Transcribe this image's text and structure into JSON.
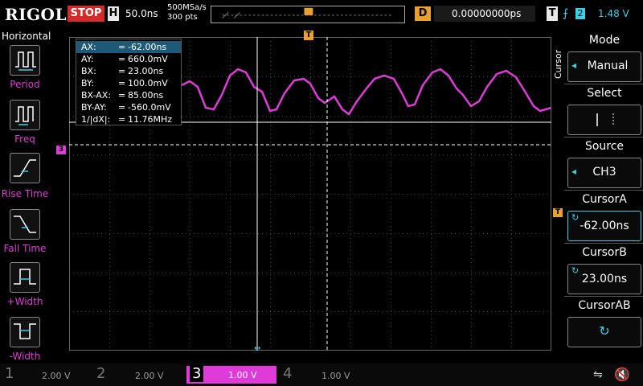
{
  "top": {
    "brand": "RIGOL",
    "run_state": "STOP",
    "h_badge": "H",
    "timebase": "50.0ns",
    "sample_rate": "500MSa/s",
    "points": "300 pts",
    "d_badge": "D",
    "delay": "0.00000000ps",
    "t_badge": "T",
    "trigger_edge_glyph": "⨍",
    "trigger_source": "2",
    "trigger_level": "1.48 V"
  },
  "left_menu": {
    "title": "Horizontal",
    "items": [
      {
        "label": "Period"
      },
      {
        "label": "Freq"
      },
      {
        "label": "Rise Time"
      },
      {
        "label": "Fall Time"
      },
      {
        "label": "+Width"
      },
      {
        "label": "-Width"
      }
    ]
  },
  "cursor_readout": {
    "rows": [
      {
        "k": "AX:",
        "eq": "=",
        "v": "-62.00ns"
      },
      {
        "k": "AY:",
        "eq": "=",
        "v": "660.0mV"
      },
      {
        "k": "BX:",
        "eq": "=",
        "v": "23.00ns"
      },
      {
        "k": "BY:",
        "eq": "=",
        "v": "100.0mV"
      },
      {
        "k": "BX-AX:",
        "eq": "=",
        "v": "85.00ns"
      },
      {
        "k": "BY-AY:",
        "eq": "=",
        "v": "-560.0mV"
      },
      {
        "k": "1/|dX|:",
        "eq": "=",
        "v": "11.76MHz"
      }
    ]
  },
  "markers": {
    "trigger_pos": "T",
    "ch3_marker": "3",
    "trigger_level_marker": "T"
  },
  "right_menu": {
    "vertical_title": "Cursor",
    "mode_label": "Mode",
    "mode_value": "Manual",
    "select_label": "Select",
    "source_label": "Source",
    "source_value": "CH3",
    "cursora_label": "CursorA",
    "cursora_value": "-62.00ns",
    "cursorb_label": "CursorB",
    "cursorb_value": "23.00ns",
    "cursorab_label": "CursorAB"
  },
  "channels": [
    {
      "num": "1",
      "scale": "2.00 V"
    },
    {
      "num": "2",
      "scale": "2.00 V"
    },
    {
      "num": "3",
      "scale": "1.00 V"
    },
    {
      "num": "4",
      "scale": "1.00 V"
    }
  ],
  "colors": {
    "ch3": "#e03ad8",
    "trigger": "#e8a030",
    "accent": "#3ad0e8",
    "stop": "#d42a2a",
    "selected_row": "#1e5a78"
  }
}
